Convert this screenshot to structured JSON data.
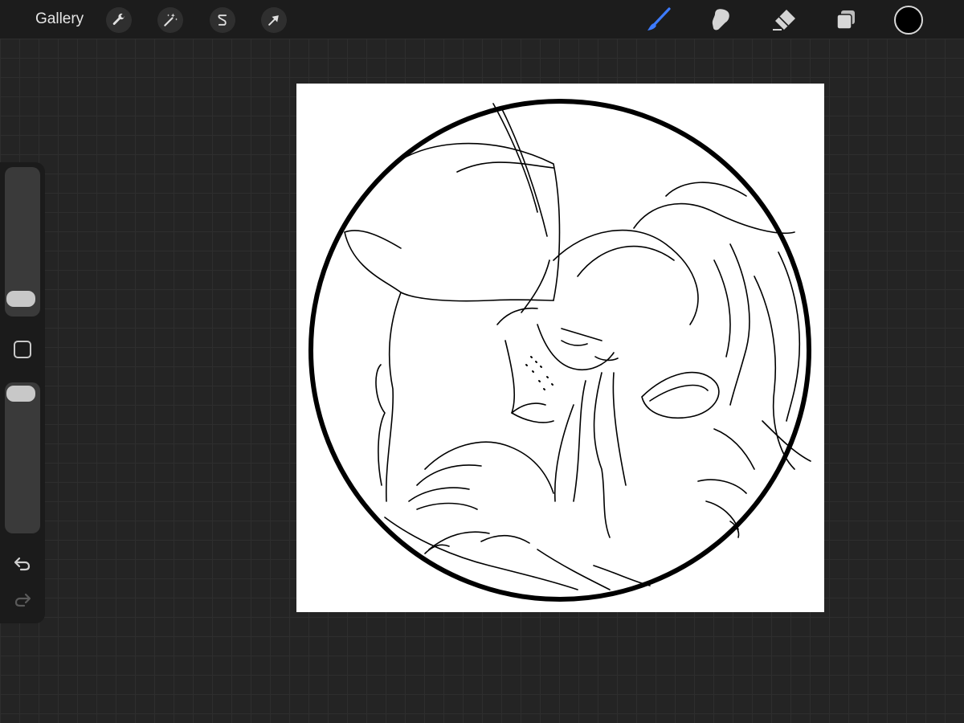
{
  "topbar": {
    "gallery_label": "Gallery",
    "left_tools": [
      {
        "icon": "wrench-icon",
        "name": "actions"
      },
      {
        "icon": "magic-wand-icon",
        "name": "adjustments"
      },
      {
        "icon": "selection-icon",
        "name": "selection"
      },
      {
        "icon": "transform-arrow-icon",
        "name": "transform"
      }
    ],
    "right_tools": [
      {
        "icon": "brush-icon",
        "name": "brush",
        "active": true
      },
      {
        "icon": "smudge-icon",
        "name": "smudge"
      },
      {
        "icon": "eraser-icon",
        "name": "eraser"
      },
      {
        "icon": "layers-icon",
        "name": "layers"
      }
    ],
    "current_color": "#000000"
  },
  "sidebar": {
    "brush_size_level": 0.1,
    "brush_opacity_level": 1.0,
    "undo_icon": "undo-icon",
    "redo_icon": "redo-icon"
  },
  "colors": {
    "accent": "#3d7bff",
    "background": "#242424",
    "toolbar": "#1c1c1c"
  },
  "canvas": {
    "content": "line-art-sketch"
  }
}
